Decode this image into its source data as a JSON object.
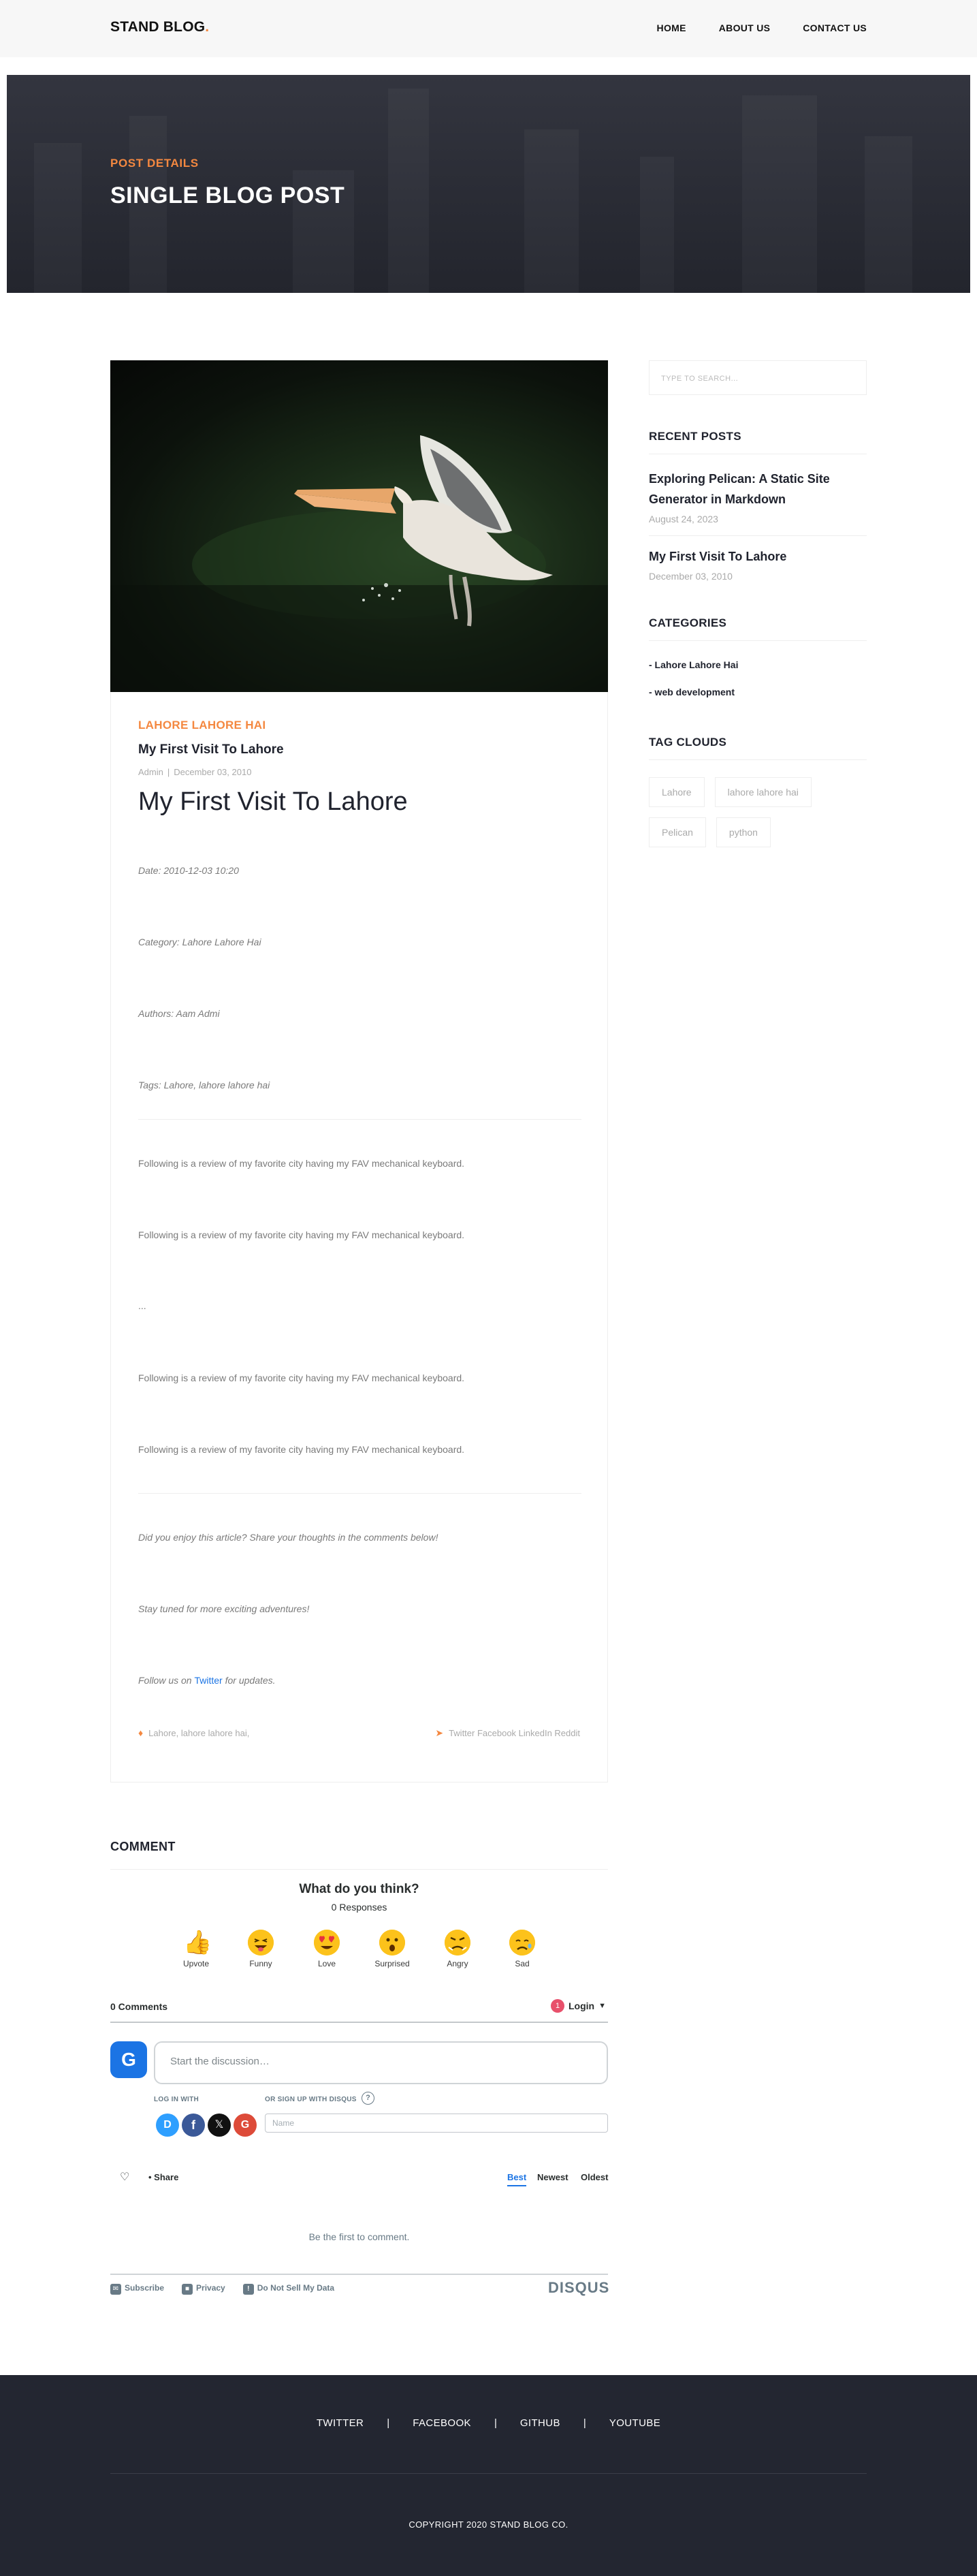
{
  "header": {
    "logo": "STAND BLOG",
    "logo_dot": ".",
    "nav": [
      "HOME",
      "ABOUT US",
      "CONTACT US"
    ]
  },
  "hero": {
    "subtitle": "POST DETAILS",
    "title": "SINGLE BLOG POST"
  },
  "post": {
    "image_alt": "Pelican taking off from water",
    "category": "LAHORE LAHORE HAI",
    "title": "My First Visit To Lahore",
    "author": "Admin",
    "date": "December 03, 2010",
    "heading": "My First Visit To Lahore",
    "meta_date": "Date: 2010-12-03 10:20",
    "meta_category": "Category: Lahore Lahore Hai",
    "meta_authors": "Authors: Aam Admi",
    "meta_tags": "Tags: Lahore, lahore lahore hai",
    "paragraph_1": "Following is a review of my favorite city having my FAV mechanical keyboard.",
    "paragraph_2": "Following is a review of my favorite city having my FAV mechanical keyboard.",
    "ellipsis": "...",
    "paragraph_3": "Following is a review of my favorite city having my FAV mechanical keyboard.",
    "paragraph_4": "Following is a review of my favorite city having my FAV mechanical keyboard.",
    "closing_1": "Did you enjoy this article? Share your thoughts in the comments below!",
    "closing_2": "Stay tuned for more exciting adventures!",
    "follow_prefix": "Follow us on ",
    "follow_link": "Twitter",
    "follow_suffix": " for updates.",
    "tags_line": "Lahore, lahore lahore hai,",
    "share_line": "Twitter Facebook LinkedIn Reddit"
  },
  "sidebar": {
    "search_placeholder": "TYPE TO SEARCH...",
    "recent_heading": "RECENT POSTS",
    "recent": [
      {
        "title": "Exploring Pelican: A Static Site Generator in Markdown",
        "date": "August 24, 2023"
      },
      {
        "title": "My First Visit To Lahore",
        "date": "December 03, 2010"
      }
    ],
    "categories_heading": "CATEGORIES",
    "categories": [
      "- Lahore Lahore Hai",
      "- web development"
    ],
    "tags_heading": "TAG CLOUDS",
    "tags": [
      "Lahore",
      "lahore lahore hai",
      "Pelican",
      "python"
    ]
  },
  "comments": {
    "heading": "COMMENT",
    "question": "What do you think?",
    "responses": "0 Responses",
    "reactions": [
      "Upvote",
      "Funny",
      "Love",
      "Surprised",
      "Angry",
      "Sad"
    ],
    "count": "0 Comments",
    "notif": "1",
    "login": "Login",
    "avatar_letter": "G",
    "discussion_placeholder": "Start the discussion…",
    "login_with": "LOG IN WITH",
    "signup_with": "OR SIGN UP WITH DISQUS",
    "help": "?",
    "name_placeholder": "Name",
    "share": "Share",
    "sort": [
      "Best",
      "Newest",
      "Oldest"
    ],
    "empty": "Be the first to comment.",
    "subscribe": "Subscribe",
    "privacy": "Privacy",
    "dnsmd": "Do Not Sell My Data",
    "brand": "DISQUS"
  },
  "footer": {
    "links": [
      "TWITTER",
      "FACEBOOK",
      "GITHUB",
      "YOUTUBE"
    ],
    "separator": "|",
    "copyright": "COPYRIGHT 2020 STAND BLOG CO."
  },
  "colors": {
    "accent": "#f48840",
    "dark": "#232631",
    "disqus_blue": "#1b74e4"
  }
}
